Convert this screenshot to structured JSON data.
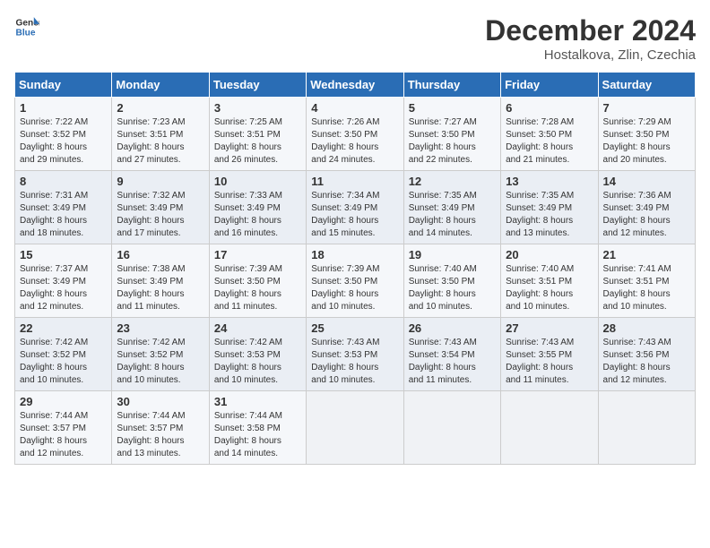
{
  "header": {
    "logo_line1": "General",
    "logo_line2": "Blue",
    "title": "December 2024",
    "subtitle": "Hostalkova, Zlin, Czechia"
  },
  "weekdays": [
    "Sunday",
    "Monday",
    "Tuesday",
    "Wednesday",
    "Thursday",
    "Friday",
    "Saturday"
  ],
  "weeks": [
    [
      {
        "day": "1",
        "sunrise": "7:22 AM",
        "sunset": "3:52 PM",
        "daylight": "8 hours and 29 minutes."
      },
      {
        "day": "2",
        "sunrise": "7:23 AM",
        "sunset": "3:51 PM",
        "daylight": "8 hours and 27 minutes."
      },
      {
        "day": "3",
        "sunrise": "7:25 AM",
        "sunset": "3:51 PM",
        "daylight": "8 hours and 26 minutes."
      },
      {
        "day": "4",
        "sunrise": "7:26 AM",
        "sunset": "3:50 PM",
        "daylight": "8 hours and 24 minutes."
      },
      {
        "day": "5",
        "sunrise": "7:27 AM",
        "sunset": "3:50 PM",
        "daylight": "8 hours and 22 minutes."
      },
      {
        "day": "6",
        "sunrise": "7:28 AM",
        "sunset": "3:50 PM",
        "daylight": "8 hours and 21 minutes."
      },
      {
        "day": "7",
        "sunrise": "7:29 AM",
        "sunset": "3:50 PM",
        "daylight": "8 hours and 20 minutes."
      }
    ],
    [
      {
        "day": "8",
        "sunrise": "7:31 AM",
        "sunset": "3:49 PM",
        "daylight": "8 hours and 18 minutes."
      },
      {
        "day": "9",
        "sunrise": "7:32 AM",
        "sunset": "3:49 PM",
        "daylight": "8 hours and 17 minutes."
      },
      {
        "day": "10",
        "sunrise": "7:33 AM",
        "sunset": "3:49 PM",
        "daylight": "8 hours and 16 minutes."
      },
      {
        "day": "11",
        "sunrise": "7:34 AM",
        "sunset": "3:49 PM",
        "daylight": "8 hours and 15 minutes."
      },
      {
        "day": "12",
        "sunrise": "7:35 AM",
        "sunset": "3:49 PM",
        "daylight": "8 hours and 14 minutes."
      },
      {
        "day": "13",
        "sunrise": "7:35 AM",
        "sunset": "3:49 PM",
        "daylight": "8 hours and 13 minutes."
      },
      {
        "day": "14",
        "sunrise": "7:36 AM",
        "sunset": "3:49 PM",
        "daylight": "8 hours and 12 minutes."
      }
    ],
    [
      {
        "day": "15",
        "sunrise": "7:37 AM",
        "sunset": "3:49 PM",
        "daylight": "8 hours and 12 minutes."
      },
      {
        "day": "16",
        "sunrise": "7:38 AM",
        "sunset": "3:49 PM",
        "daylight": "8 hours and 11 minutes."
      },
      {
        "day": "17",
        "sunrise": "7:39 AM",
        "sunset": "3:50 PM",
        "daylight": "8 hours and 11 minutes."
      },
      {
        "day": "18",
        "sunrise": "7:39 AM",
        "sunset": "3:50 PM",
        "daylight": "8 hours and 10 minutes."
      },
      {
        "day": "19",
        "sunrise": "7:40 AM",
        "sunset": "3:50 PM",
        "daylight": "8 hours and 10 minutes."
      },
      {
        "day": "20",
        "sunrise": "7:40 AM",
        "sunset": "3:51 PM",
        "daylight": "8 hours and 10 minutes."
      },
      {
        "day": "21",
        "sunrise": "7:41 AM",
        "sunset": "3:51 PM",
        "daylight": "8 hours and 10 minutes."
      }
    ],
    [
      {
        "day": "22",
        "sunrise": "7:42 AM",
        "sunset": "3:52 PM",
        "daylight": "8 hours and 10 minutes."
      },
      {
        "day": "23",
        "sunrise": "7:42 AM",
        "sunset": "3:52 PM",
        "daylight": "8 hours and 10 minutes."
      },
      {
        "day": "24",
        "sunrise": "7:42 AM",
        "sunset": "3:53 PM",
        "daylight": "8 hours and 10 minutes."
      },
      {
        "day": "25",
        "sunrise": "7:43 AM",
        "sunset": "3:53 PM",
        "daylight": "8 hours and 10 minutes."
      },
      {
        "day": "26",
        "sunrise": "7:43 AM",
        "sunset": "3:54 PM",
        "daylight": "8 hours and 11 minutes."
      },
      {
        "day": "27",
        "sunrise": "7:43 AM",
        "sunset": "3:55 PM",
        "daylight": "8 hours and 11 minutes."
      },
      {
        "day": "28",
        "sunrise": "7:43 AM",
        "sunset": "3:56 PM",
        "daylight": "8 hours and 12 minutes."
      }
    ],
    [
      {
        "day": "29",
        "sunrise": "7:44 AM",
        "sunset": "3:57 PM",
        "daylight": "8 hours and 12 minutes."
      },
      {
        "day": "30",
        "sunrise": "7:44 AM",
        "sunset": "3:57 PM",
        "daylight": "8 hours and 13 minutes."
      },
      {
        "day": "31",
        "sunrise": "7:44 AM",
        "sunset": "3:58 PM",
        "daylight": "8 hours and 14 minutes."
      },
      null,
      null,
      null,
      null
    ]
  ]
}
